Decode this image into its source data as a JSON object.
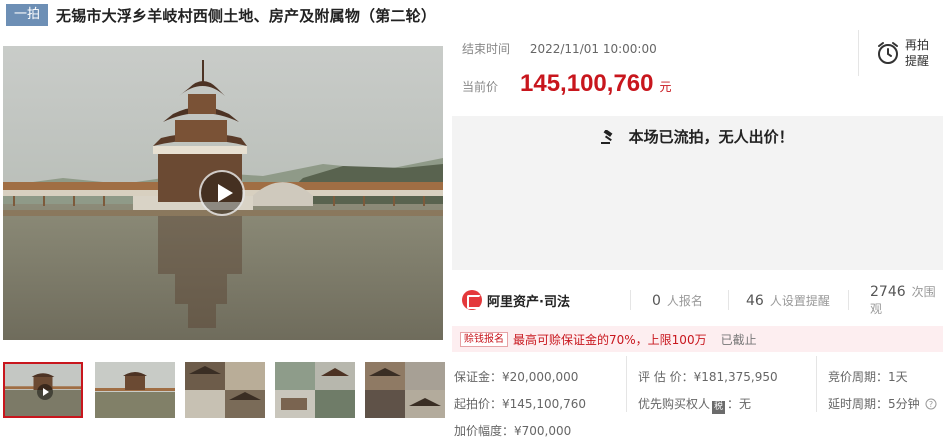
{
  "header": {
    "tag": "一拍",
    "title": "无锡市大浮乡羊岐村西侧土地、房产及附属物（第二轮）"
  },
  "auction": {
    "end_label": "结束时间",
    "end_value": "2022/11/01 10:00:00",
    "price_label": "当前价",
    "price_value": "145,100,760",
    "price_unit": "元",
    "remind_label": "再拍提醒",
    "status_text": "本场已流拍，无人出价！"
  },
  "stats": {
    "brand": "阿里资产·司法",
    "signups_count": "0",
    "signups_label": "人报名",
    "reminders_count": "46",
    "reminders_label": "人设置提醒",
    "views_count": "2746",
    "views_label": "次围观"
  },
  "deposit": {
    "badge": "赊钱报名",
    "text": "最高可赊保证金的70%，上限100万",
    "status": "已截止"
  },
  "details": {
    "deposit_label": "保证金：",
    "deposit_value": "¥20,000,000",
    "appraisal_label": "评 估 价：",
    "appraisal_value": "¥181,375,950",
    "cycle_label": "竞价周期：",
    "cycle_value": "1天",
    "start_label": "起拍价：",
    "start_value": "¥145,100,760",
    "priority_label": "优先购买权人",
    "priority_icon": "税",
    "priority_value": "：无",
    "delay_label": "延时周期：",
    "delay_value": "5分钟",
    "increment_label": "加价幅度：",
    "increment_value": "¥700,000"
  },
  "colors": {
    "accent": "#c8161d",
    "tag_bg": "#6d8fb5",
    "status_bg": "#f3f3f3",
    "deposit_bg": "#fdeef0"
  },
  "media": {
    "thumbnails": [
      "pavilion-video",
      "pavilion-lake",
      "old-buildings",
      "pavilion-collage",
      "building-collage"
    ]
  }
}
